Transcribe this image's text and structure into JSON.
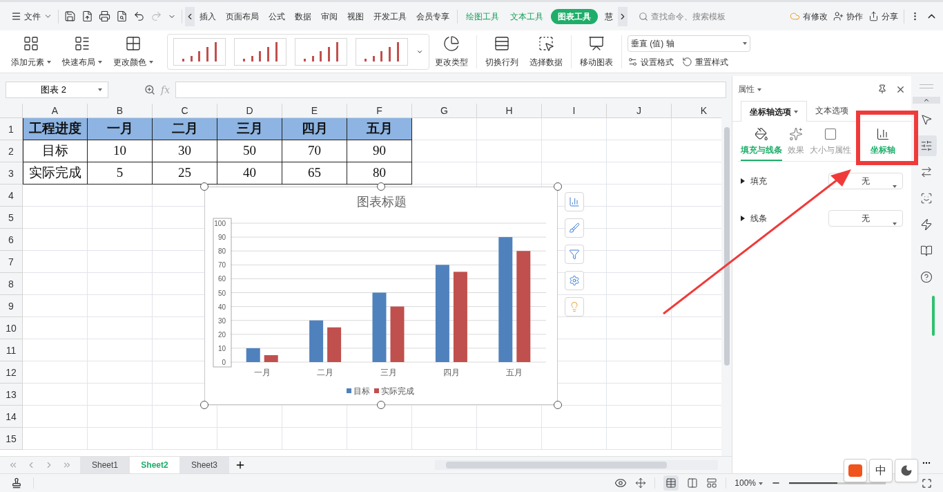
{
  "top_bar": {
    "menu": "文件",
    "tabs": [
      {
        "label": "插入",
        "kind": "normal",
        "selected": false
      },
      {
        "label": "页面布局",
        "kind": "normal",
        "selected": false
      },
      {
        "label": "公式",
        "kind": "normal",
        "selected": false
      },
      {
        "label": "数据",
        "kind": "normal",
        "selected": false
      },
      {
        "label": "审阅",
        "kind": "normal",
        "selected": false
      },
      {
        "label": "视图",
        "kind": "normal",
        "selected": false
      },
      {
        "label": "开发工具",
        "kind": "normal",
        "selected": false
      },
      {
        "label": "会员专享",
        "kind": "normal",
        "selected": false
      },
      {
        "label": "绘图工具",
        "kind": "context",
        "selected": false
      },
      {
        "label": "文本工具",
        "kind": "context",
        "selected": false
      },
      {
        "label": "图表工具",
        "kind": "context",
        "selected": true
      },
      {
        "label": "慧",
        "kind": "normal",
        "selected": false
      }
    ],
    "search": {
      "placeholder": "查找命令、搜索模板"
    },
    "actions": [
      "有修改",
      "协作",
      "分享"
    ]
  },
  "ribbon": {
    "left_buttons": [
      {
        "label": "添加元素",
        "dropdown": true
      },
      {
        "label": "快速布局",
        "dropdown": true
      },
      {
        "label": "更改颜色",
        "dropdown": true
      }
    ],
    "right_buttons": [
      {
        "label": "更改类型",
        "dropdown": false
      },
      {
        "label": "切换行列",
        "dropdown": false
      },
      {
        "label": "选择数据",
        "dropdown": false
      },
      {
        "label": "移动图表",
        "dropdown": false
      }
    ],
    "element_select": "垂直 (值) 轴",
    "small_buttons": [
      "设置格式",
      "重置样式"
    ]
  },
  "formula_bar": {
    "name_box": "图表 2",
    "fx": "fx"
  },
  "sheet": {
    "columns": [
      "A",
      "B",
      "C",
      "D",
      "E",
      "F",
      "G",
      "H",
      "I",
      "J",
      "K"
    ],
    "row_numbers": [
      "1",
      "2",
      "3",
      "4",
      "5",
      "6",
      "7",
      "8",
      "9",
      "10",
      "11",
      "12",
      "13",
      "14",
      "15"
    ],
    "table": {
      "header": [
        "工程进度",
        "一月",
        "二月",
        "三月",
        "四月",
        "五月"
      ],
      "rows": [
        [
          "目标",
          "10",
          "30",
          "50",
          "70",
          "90"
        ],
        [
          "实际完成",
          "5",
          "25",
          "40",
          "65",
          "80"
        ]
      ]
    }
  },
  "chart": {
    "chart_data": {
      "type": "bar",
      "title": "图表标题",
      "categories": [
        "一月",
        "二月",
        "三月",
        "四月",
        "五月"
      ],
      "series": [
        {
          "name": "目标",
          "color": "#4f81bd",
          "values": [
            10,
            30,
            50,
            70,
            90
          ]
        },
        {
          "name": "实际完成",
          "color": "#c0504d",
          "values": [
            5,
            25,
            40,
            65,
            80
          ]
        }
      ],
      "ylim": [
        0,
        100
      ],
      "yticks": [
        0,
        10,
        20,
        30,
        40,
        50,
        60,
        70,
        80,
        90,
        100
      ],
      "grid": true,
      "legend": "bottom"
    }
  },
  "panel": {
    "title": "属性",
    "tabs": [
      {
        "label": "坐标轴选项",
        "selected": true
      },
      {
        "label": "文本选项",
        "selected": false
      }
    ],
    "subtabs": [
      {
        "label": "填充与线条",
        "selected": true,
        "highlighted": false
      },
      {
        "label": "效果",
        "selected": false,
        "highlighted": false
      },
      {
        "label": "大小与属性",
        "selected": false,
        "highlighted": false
      },
      {
        "label": "坐标轴",
        "selected": false,
        "highlighted": true
      }
    ],
    "properties": [
      {
        "label": "填充",
        "value": "无",
        "expanded": false
      },
      {
        "label": "线条",
        "value": "无",
        "expanded": false
      }
    ]
  },
  "sheet_tabs": [
    {
      "label": "Sheet1",
      "selected": false
    },
    {
      "label": "Sheet2",
      "selected": true
    },
    {
      "label": "Sheet3",
      "selected": false
    }
  ],
  "status_bar": {
    "zoom": "100%",
    "zoom_slider": {
      "level": 0.5
    }
  },
  "ime": {
    "mode": "中"
  }
}
